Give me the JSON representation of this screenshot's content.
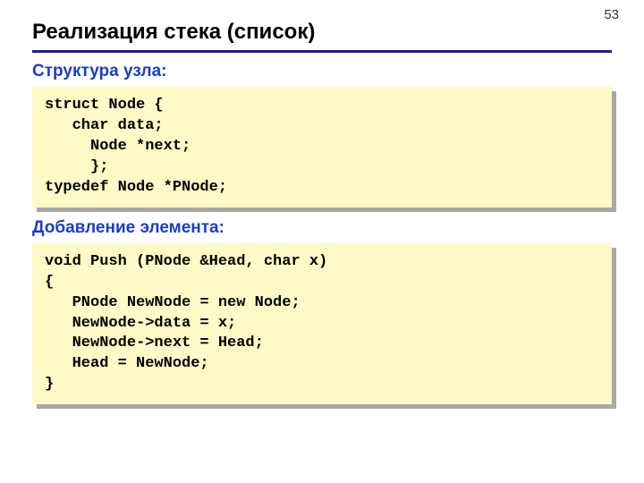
{
  "page_number": "53",
  "title": "Реализация стека (список)",
  "sections": {
    "struct_label": "Структура узла:",
    "add_label": "Добавление элемента:"
  },
  "code": {
    "struct": "struct Node {\n   char data;\n     Node *next;\n     };\ntypedef Node *PNode;",
    "push": "void Push (PNode &Head, char x)\n{\n   PNode NewNode = new Node;\n   NewNode->data = x;\n   NewNode->next = Head;\n   Head = NewNode;\n}"
  }
}
